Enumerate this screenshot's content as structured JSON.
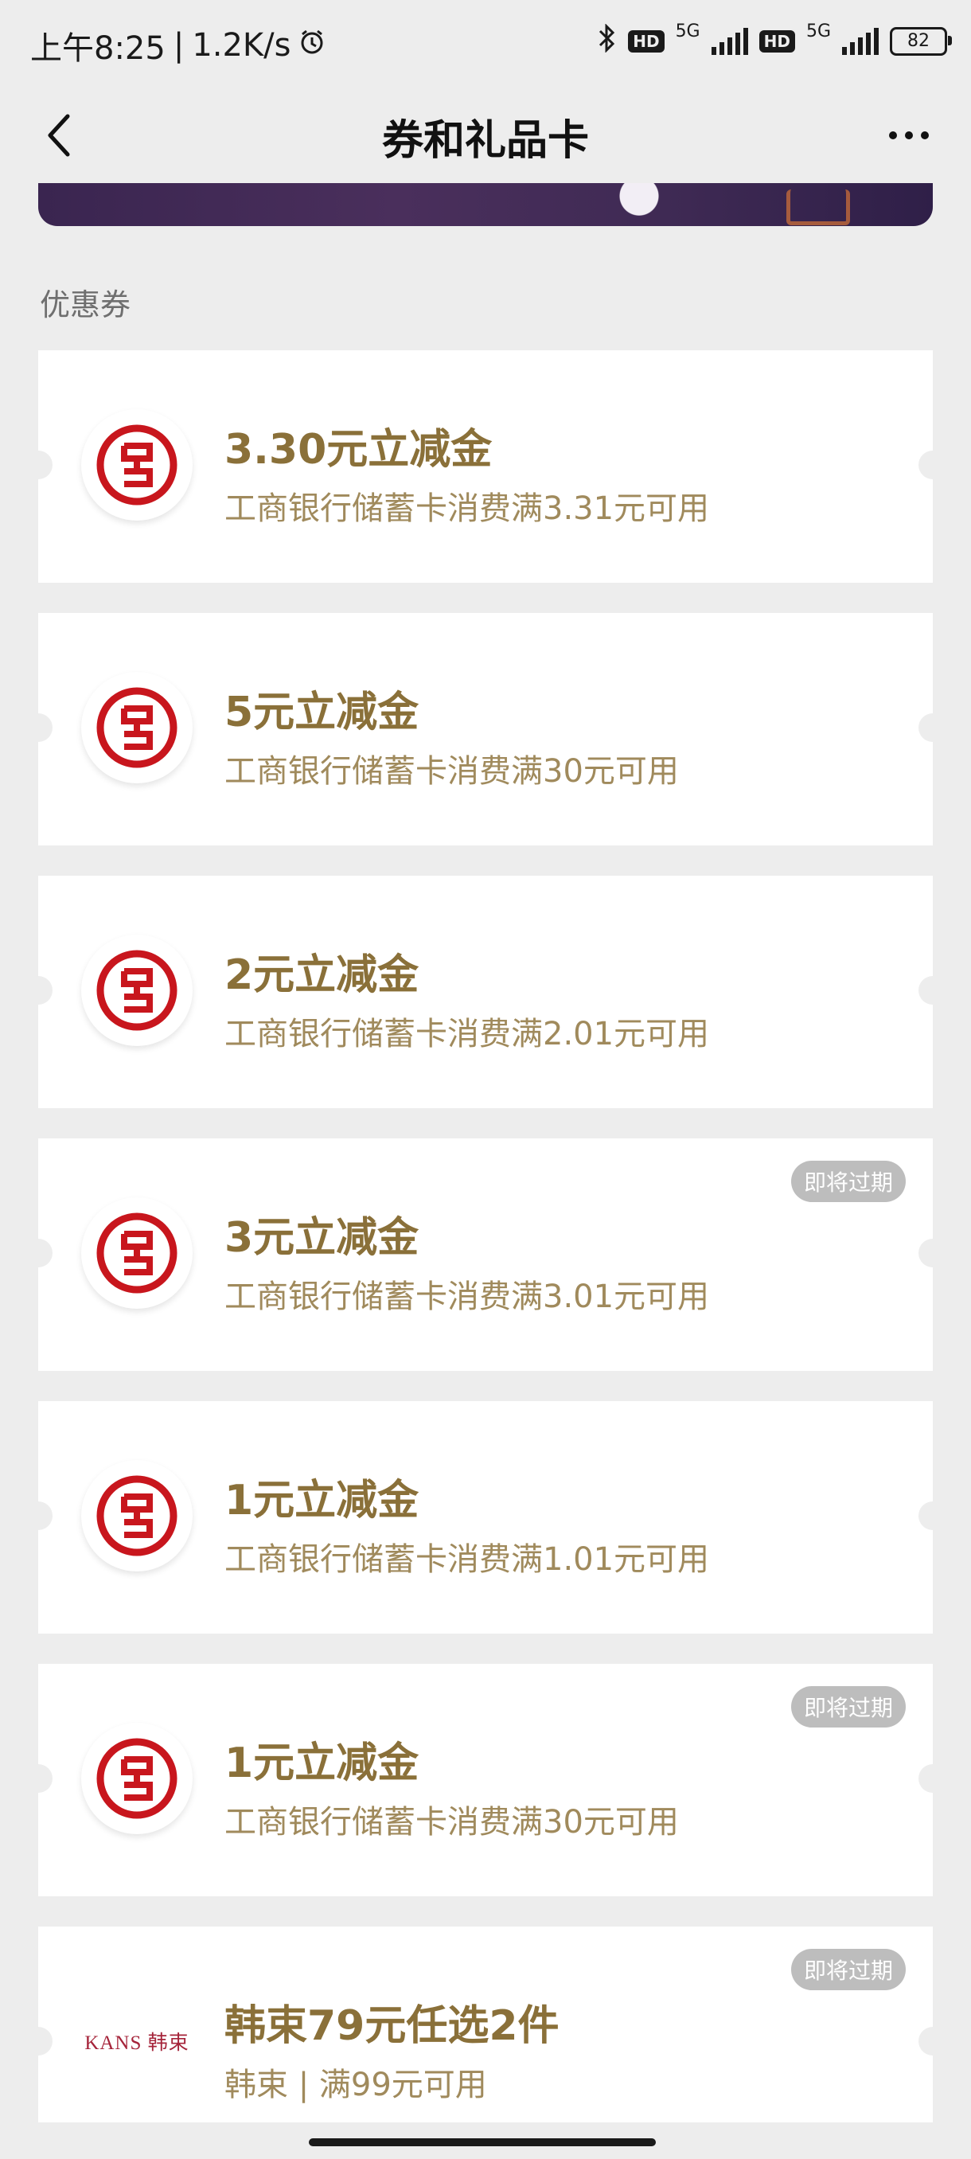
{
  "status_bar": {
    "time": "上午8:25",
    "net_speed": "1.2K/s",
    "hd1": "HD",
    "net1": "5G",
    "hd2": "HD",
    "net2": "5G",
    "battery": "82"
  },
  "nav": {
    "title": "券和礼品卡"
  },
  "section": {
    "title": "优惠券"
  },
  "coupons": [
    {
      "title": "3.30元立减金",
      "desc": "工商银行储蓄卡消费满3.31元可用",
      "badge": "",
      "logo": "icbc-logo-icon"
    },
    {
      "title": "5元立减金",
      "desc": "工商银行储蓄卡消费满30元可用",
      "badge": "",
      "logo": "icbc-logo-icon"
    },
    {
      "title": "2元立减金",
      "desc": "工商银行储蓄卡消费满2.01元可用",
      "badge": "",
      "logo": "icbc-logo-icon"
    },
    {
      "title": "3元立减金",
      "desc": "工商银行储蓄卡消费满3.01元可用",
      "badge": "即将过期",
      "logo": "icbc-logo-icon"
    },
    {
      "title": "1元立减金",
      "desc": "工商银行储蓄卡消费满1.01元可用",
      "badge": "",
      "logo": "icbc-logo-icon"
    },
    {
      "title": "1元立减金",
      "desc": "工商银行储蓄卡消费满30元可用",
      "badge": "即将过期",
      "logo": "icbc-logo-icon"
    },
    {
      "title": "韩束79元任选2件",
      "desc": "韩束 | 满99元可用",
      "badge": "即将过期",
      "logo_text": "KANS 韩束"
    }
  ],
  "colors": {
    "title": "#8a7039",
    "desc": "#a08a5c",
    "icbc_red": "#c8161d",
    "page_bg": "#ededed"
  }
}
